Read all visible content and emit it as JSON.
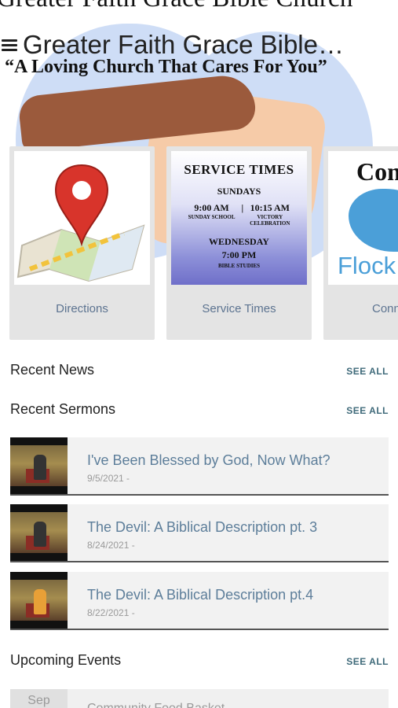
{
  "header": {
    "top_title": "Greater Faith Grace Bible Church",
    "app_title": "Greater Faith Grace Bible…",
    "tagline": "“A Loving Church That Cares For You”"
  },
  "cards": [
    {
      "label": "Directions"
    },
    {
      "label": "Service Times"
    },
    {
      "label": "Conn"
    }
  ],
  "service_times": {
    "heading": "SERVICE TIMES",
    "sundays": "SUNDAYS",
    "time1": "9:00 AM",
    "sep": "|",
    "time2": "10:15 AM",
    "sub1": "SUNDAY SCHOOL",
    "sub2a": "VICTORY",
    "sub2b": "CELEBRATION",
    "wednesday": "WEDNESDAY",
    "time3": "7:00 PM",
    "sub3": "BIBLE STUDIES"
  },
  "connect_card": {
    "word": "Conn",
    "flock": "Flock"
  },
  "sections": {
    "news": {
      "title": "Recent News",
      "see_all": "SEE ALL"
    },
    "sermons": {
      "title": "Recent Sermons",
      "see_all": "SEE ALL"
    },
    "events": {
      "title": "Upcoming Events",
      "see_all": "SEE ALL"
    }
  },
  "sermons": [
    {
      "title": "I've Been Blessed by God, Now What?",
      "date": "9/5/2021 -"
    },
    {
      "title": "The Devil: A Biblical Description pt. 3",
      "date": "8/24/2021 -"
    },
    {
      "title": "The Devil: A Biblical Description pt.4",
      "date": "8/22/2021 -"
    }
  ],
  "event": {
    "month": "Sep",
    "title": "Community Food Basket"
  },
  "colors": {
    "accent": "#5d7e9a",
    "see_all": "#3f6a7a",
    "card_bg": "#e4e4e4",
    "sermon_bg": "#f2f2f2"
  }
}
